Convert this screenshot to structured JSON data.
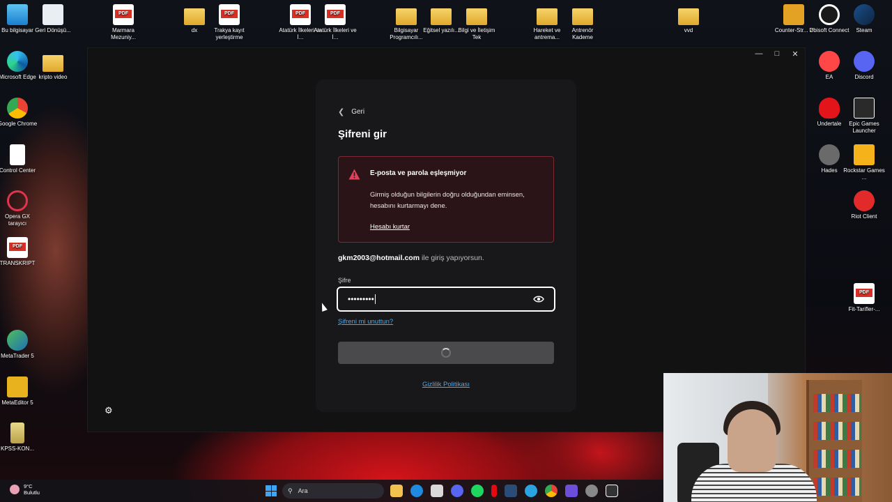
{
  "desktop": {
    "icons_left": [
      {
        "label": "Bu bilgisayar",
        "icon": "computer-icon"
      },
      {
        "label": "Geri Dönüşü...",
        "icon": "recycle-bin-icon"
      },
      {
        "label": "Microsoft Edge",
        "icon": "edge-icon"
      },
      {
        "label": "kripto video",
        "icon": "folder-icon"
      },
      {
        "label": "Google Chrome",
        "icon": "chrome-icon"
      },
      {
        "label": "Control Center",
        "icon": "document-icon"
      },
      {
        "label": "Opera GX tarayıcı",
        "icon": "opera-gx-icon"
      },
      {
        "label": "TRANSKRIPT",
        "icon": "pdf-icon"
      },
      {
        "label": "MetaTrader 5",
        "icon": "metatrader-icon"
      },
      {
        "label": "MetaEditor 5",
        "icon": "metaeditor-icon"
      },
      {
        "label": "KPSS-KON...",
        "icon": "archive-icon"
      }
    ],
    "icons_top": [
      {
        "label": "Marmara Mezuniy...",
        "icon": "pdf-icon"
      },
      {
        "label": "dx",
        "icon": "folder-icon"
      },
      {
        "label": "Trakya kayıt yerleştirme",
        "icon": "pdf-icon"
      },
      {
        "label": "Atatürk İlkeleri ve İ...",
        "icon": "pdf-icon"
      },
      {
        "label": "Atatürk İlkeleri ve İ...",
        "icon": "pdf-icon"
      },
      {
        "label": "Bilgisayar Programcılı...",
        "icon": "folder-icon"
      },
      {
        "label": "Eğitsel yazılı...",
        "icon": "folder-icon"
      },
      {
        "label": "Bilgi ve İletişim Tek",
        "icon": "folder-icon"
      },
      {
        "label": "Hareket ve antrema...",
        "icon": "folder-icon"
      },
      {
        "label": "Antrenör Kademe",
        "icon": "folder-icon"
      },
      {
        "label": "vvd",
        "icon": "folder-icon"
      }
    ],
    "icons_right": [
      {
        "label": "Counter-Str... 2",
        "icon": "cs2-icon"
      },
      {
        "label": "Ubisoft Connect",
        "icon": "ubisoft-icon"
      },
      {
        "label": "Steam",
        "icon": "steam-icon"
      },
      {
        "label": "EA",
        "icon": "ea-icon"
      },
      {
        "label": "Discord",
        "icon": "discord-icon"
      },
      {
        "label": "Undertale",
        "icon": "undertale-icon"
      },
      {
        "label": "Epic Games Launcher",
        "icon": "epic-games-icon"
      },
      {
        "label": "Hades",
        "icon": "hades-icon"
      },
      {
        "label": "Rockstar Games ...",
        "icon": "rockstar-icon"
      },
      {
        "label": "Riot Client",
        "icon": "riot-icon"
      },
      {
        "label": "Fit-Tarifler-...",
        "icon": "pdf-icon"
      }
    ]
  },
  "login": {
    "back_label": "Geri",
    "title": "Şifreni gir",
    "alert": {
      "title": "E-posta ve parola eşleşmiyor",
      "body": "Girmiş olduğun bilgilerin doğru olduğundan eminsen, hesabını kurtarmayı dene.",
      "link": "Hesabı kurtar"
    },
    "email": "gkm2003@hotmail.com",
    "email_suffix": " ile giriş yapıyorsun.",
    "password_label": "Şifre",
    "password_mask": "•••••••••",
    "forgot_link": "Şifreni mi unuttun?",
    "privacy_link": "Gizlilik Politikası"
  },
  "taskbar": {
    "temperature": "9°C",
    "weather": "Bulutlu",
    "search_placeholder": "Ara"
  },
  "colors": {
    "alert_bg": "#2a1417",
    "alert_border": "#7a2a33",
    "warning": "#e0405a",
    "link": "#4fa9e8",
    "windows_accent": "#3ea6f4"
  }
}
